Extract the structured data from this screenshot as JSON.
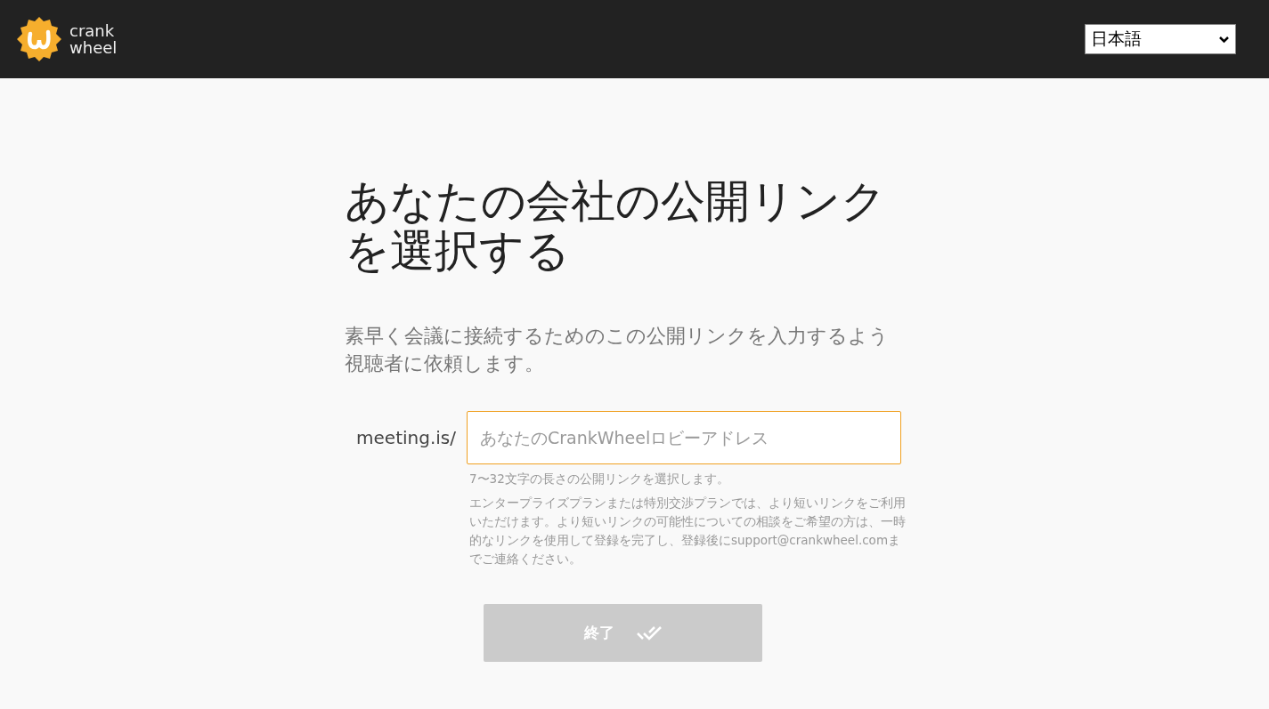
{
  "header": {
    "logo_text": [
      "crank",
      "wheel"
    ],
    "language": "日本語"
  },
  "title": "あなたの会社の公開リンクを選択する",
  "subtitle": "素早く会議に接続するためのこの公開リンクを入力するよう視聴者に依頼します。",
  "link_field": {
    "prefix": "meeting.is/",
    "placeholder": "あなたのCrankWheelロビーアドレス"
  },
  "hints": [
    "7〜32文字の長さの公開リンクを選択します。",
    "エンタープライズプランまたは特別交渉プランでは、より短いリンクをご利用いただけます。より短いリンクの可能性についての相談をご希望の方は、一時的なリンクを使用して登録を完了し、登録後にsupport@crankwheel.comまでご連絡ください。"
  ],
  "finish_button": {
    "label": "終了",
    "disabled": true
  }
}
